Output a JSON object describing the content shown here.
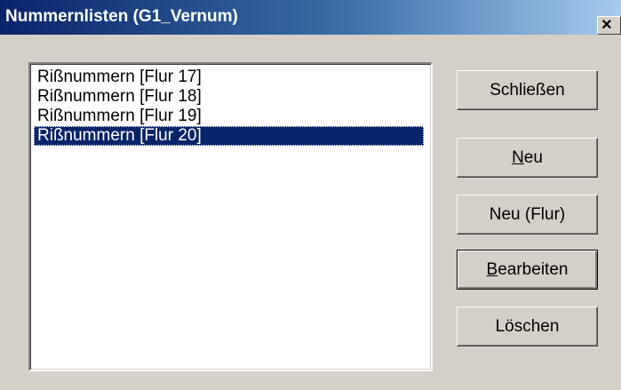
{
  "window": {
    "title": "Nummernlisten (G1_Vernum)",
    "close_label": "×"
  },
  "list": {
    "items": [
      {
        "label": "Rißnummern [Flur 17]",
        "selected": false
      },
      {
        "label": "Rißnummern [Flur 18]",
        "selected": false
      },
      {
        "label": "Rißnummern [Flur 19]",
        "selected": false
      },
      {
        "label": "Rißnummern [Flur 20]",
        "selected": true
      }
    ]
  },
  "buttons": {
    "close": "Schließen",
    "new_accel": "N",
    "new_rest": "eu",
    "new_flur": "Neu (Flur)",
    "edit_accel": "B",
    "edit_rest": "earbeiten",
    "delete": "Löschen"
  },
  "colors": {
    "title_gradient_start": "#0a246a",
    "title_gradient_end": "#a6caf0",
    "selection": "#0a246a",
    "face": "#d4d0c8"
  }
}
